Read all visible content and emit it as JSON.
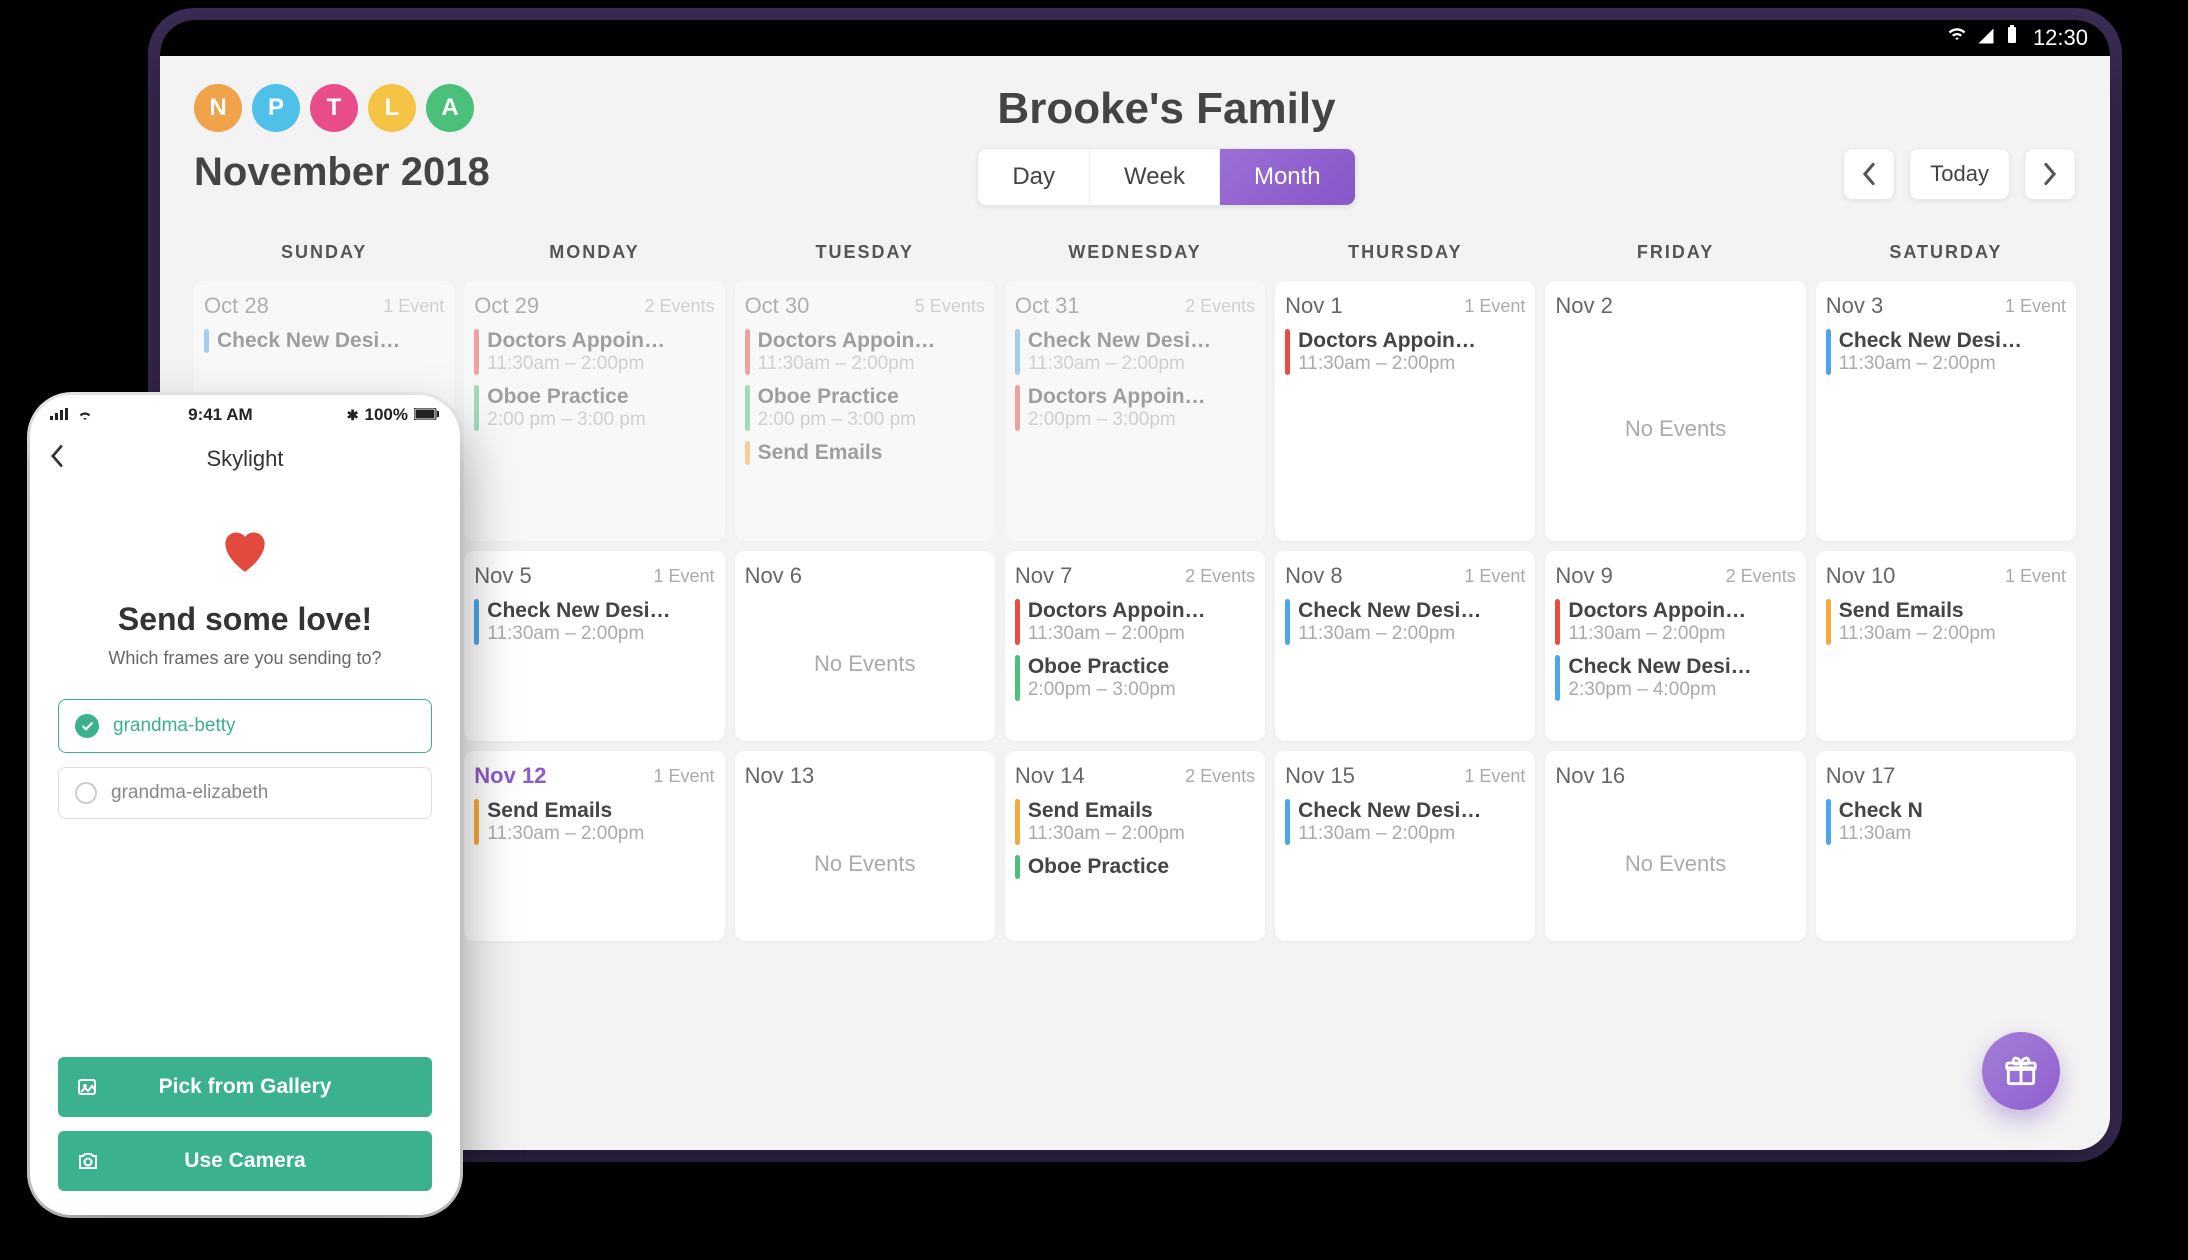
{
  "statusBar": {
    "time": "12:30"
  },
  "header": {
    "title": "Brooke's Family",
    "avatars": [
      {
        "letter": "N",
        "color": "#f1a24b"
      },
      {
        "letter": "P",
        "color": "#4fc1e9"
      },
      {
        "letter": "T",
        "color": "#e84d8a"
      },
      {
        "letter": "L",
        "color": "#f6c445"
      },
      {
        "letter": "A",
        "color": "#4bc07a"
      }
    ],
    "monthLabel": "November 2018",
    "viewTabs": [
      "Day",
      "Week",
      "Month"
    ],
    "activeTab": "Month",
    "todayLabel": "Today"
  },
  "weekdays": [
    "SUNDAY",
    "MONDAY",
    "TUESDAY",
    "WEDNESDAY",
    "THURSDAY",
    "FRIDAY",
    "SATURDAY"
  ],
  "colors": {
    "blue": "#4da6e8",
    "red": "#e84d3f",
    "green": "#4bc07a",
    "purple": "#a06fd4",
    "orange": "#f6a93b"
  },
  "days": [
    {
      "date": "Oct 28",
      "count": "1 Event",
      "faded": true,
      "events": [
        {
          "title": "Check New Desi…",
          "time": "",
          "color": "blue"
        }
      ]
    },
    {
      "date": "Oct 29",
      "count": "2 Events",
      "faded": true,
      "events": [
        {
          "title": "Doctors Appoin…",
          "time": "11:30am – 2:00pm",
          "color": "red"
        },
        {
          "title": "Oboe Practice",
          "time": "2:00 pm – 3:00 pm",
          "color": "green"
        }
      ]
    },
    {
      "date": "Oct 30",
      "count": "5 Events",
      "faded": true,
      "events": [
        {
          "title": "Doctors Appoin…",
          "time": "11:30am – 2:00pm",
          "color": "red"
        },
        {
          "title": "Oboe Practice",
          "time": "2:00 pm – 3:00 pm",
          "color": "green"
        },
        {
          "title": "Send Emails",
          "time": "",
          "color": "orange"
        }
      ]
    },
    {
      "date": "Oct 31",
      "count": "2 Events",
      "faded": true,
      "events": [
        {
          "title": "Check New Desi…",
          "time": "11:30am – 2:00pm",
          "color": "blue"
        },
        {
          "title": "Doctors Appoin…",
          "time": "2:00pm – 3:00pm",
          "color": "red"
        }
      ]
    },
    {
      "date": "Nov 1",
      "count": "1 Event",
      "faded": false,
      "events": [
        {
          "title": "Doctors Appoin…",
          "time": "11:30am – 2:00pm",
          "color": "red"
        }
      ]
    },
    {
      "date": "Nov 2",
      "count": "",
      "faded": false,
      "events": [],
      "noEvents": "No Events"
    },
    {
      "date": "Nov 3",
      "count": "1 Event",
      "faded": false,
      "events": [
        {
          "title": "Check New Desi…",
          "time": "11:30am – 2:00pm",
          "color": "blue"
        }
      ]
    },
    {
      "date": "Nov 5",
      "count": "1 Event",
      "faded": false,
      "events": [
        {
          "title": "Check New Desi…",
          "time": "11:30am – 2:00pm",
          "color": "blue"
        }
      ]
    },
    {
      "date": "Nov 6",
      "count": "",
      "faded": false,
      "events": [],
      "noEvents": "No Events"
    },
    {
      "date": "Nov 7",
      "count": "2 Events",
      "faded": false,
      "events": [
        {
          "title": "Doctors Appoin…",
          "time": "11:30am – 2:00pm",
          "color": "red"
        },
        {
          "title": "Oboe Practice",
          "time": "2:00pm – 3:00pm",
          "color": "green"
        }
      ]
    },
    {
      "date": "Nov 8",
      "count": "1 Event",
      "faded": false,
      "events": [
        {
          "title": "Check New Desi…",
          "time": "11:30am – 2:00pm",
          "color": "blue"
        }
      ]
    },
    {
      "date": "Nov 9",
      "count": "2 Events",
      "faded": false,
      "events": [
        {
          "title": "Doctors Appoin…",
          "time": "11:30am – 2:00pm",
          "color": "red"
        },
        {
          "title": "Check New Desi…",
          "time": "2:30pm – 4:00pm",
          "color": "blue"
        }
      ]
    },
    {
      "date": "Nov 10",
      "count": "1 Event",
      "faded": false,
      "events": [
        {
          "title": "Send Emails",
          "time": "11:30am – 2:00pm",
          "color": "orange"
        }
      ]
    },
    {
      "date": "Nov 12",
      "count": "1 Event",
      "today": true,
      "faded": false,
      "events": [
        {
          "title": "Send Emails",
          "time": "11:30am – 2:00pm",
          "color": "orange"
        }
      ]
    },
    {
      "date": "Nov 13",
      "count": "",
      "faded": false,
      "events": [],
      "noEvents": "No Events"
    },
    {
      "date": "Nov 14",
      "count": "2 Events",
      "faded": false,
      "events": [
        {
          "title": "Send Emails",
          "time": "11:30am – 2:00pm",
          "color": "orange"
        },
        {
          "title": "Oboe Practice",
          "time": "",
          "color": "green"
        }
      ]
    },
    {
      "date": "Nov 15",
      "count": "1 Event",
      "faded": false,
      "events": [
        {
          "title": "Check New Desi…",
          "time": "11:30am – 2:00pm",
          "color": "blue"
        }
      ]
    },
    {
      "date": "Nov 16",
      "count": "",
      "faded": false,
      "events": [],
      "noEvents": "No Events"
    },
    {
      "date": "Nov 17",
      "count": "",
      "faded": false,
      "events": [
        {
          "title": "Check N",
          "time": "11:30am",
          "color": "blue"
        }
      ]
    }
  ],
  "phone": {
    "status": {
      "carrier": "",
      "time": "9:41 AM",
      "battery": "100%",
      "bt": "✱"
    },
    "navTitle": "Skylight",
    "heading": "Send some love!",
    "sub": "Which frames are you sending to?",
    "frames": [
      {
        "name": "grandma-betty",
        "selected": true
      },
      {
        "name": "grandma-elizabeth",
        "selected": false
      }
    ],
    "galleryBtn": "Pick from Gallery",
    "cameraBtn": "Use Camera"
  }
}
